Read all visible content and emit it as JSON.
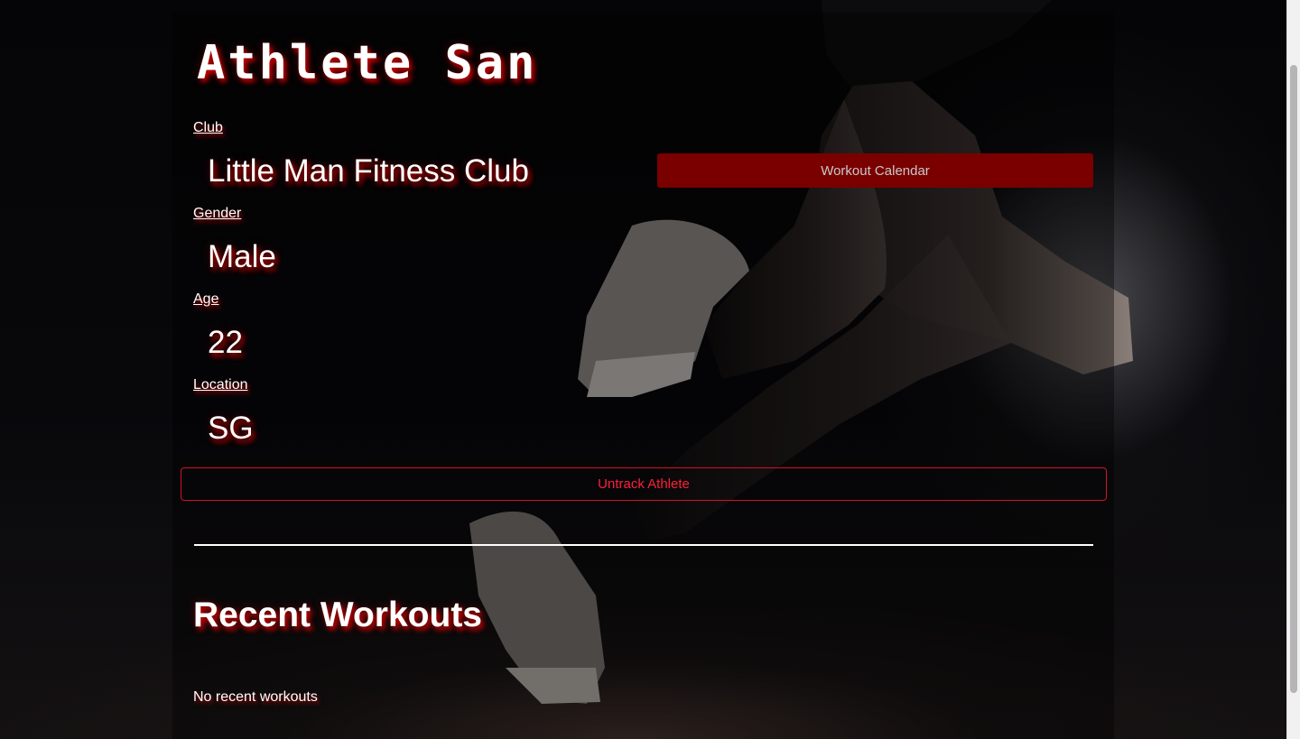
{
  "athlete": {
    "name": "Athlete San",
    "fields": [
      {
        "label": "Club",
        "value": "Little Man Fitness Club"
      },
      {
        "label": "Gender",
        "value": "Male"
      },
      {
        "label": "Age",
        "value": "22"
      },
      {
        "label": "Location",
        "value": "SG"
      }
    ]
  },
  "actions": {
    "workout_calendar_label": "Workout Calendar",
    "untrack_label": "Untrack Athlete"
  },
  "recent_workouts": {
    "title": "Recent Workouts",
    "empty_text": "No recent workouts"
  },
  "colors": {
    "accent_dark_red": "#7a0000",
    "untrack_red": "#ff1f3a",
    "text_glow": "#ff0000"
  },
  "background_image": "runner-legs-sneakers-dark"
}
